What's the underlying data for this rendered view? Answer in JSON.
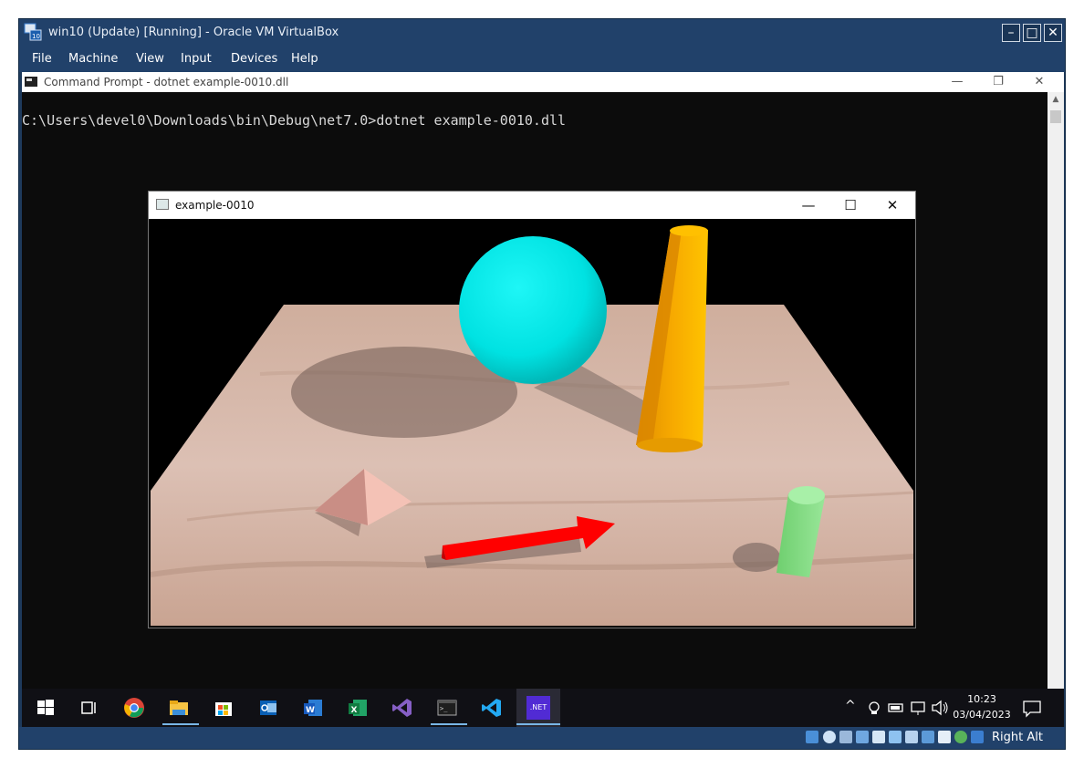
{
  "vbox": {
    "title": "win10 (Update) [Running] - Oracle VM VirtualBox",
    "controls": {
      "minimize": "–",
      "maximize": "□",
      "close": "✕"
    },
    "menu": [
      "File",
      "Machine",
      "View",
      "Input",
      "Devices",
      "Help"
    ],
    "status": {
      "host_key": "Right Alt"
    }
  },
  "cmd": {
    "title": "Command Prompt - dotnet  example-0010.dll",
    "prompt_line": "C:\\Users\\devel0\\Downloads\\bin\\Debug\\net7.0>dotnet example-0010.dll",
    "controls": {
      "minimize": "—",
      "restore": "❐",
      "close": "✕"
    }
  },
  "app_window": {
    "title": "example-0010",
    "controls": {
      "minimize": "—",
      "maximize": "☐",
      "close": "✕"
    }
  },
  "taskbar": {
    "pinned": [
      "start",
      "task-view",
      "chrome",
      "file-explorer",
      "microsoft-store",
      "outlook",
      "word",
      "excel",
      "visual-studio",
      "terminal",
      "vscode",
      "dotnet"
    ],
    "dotnet_label": ".NET",
    "clock": {
      "time": "10:23",
      "date": "03/04/2023"
    }
  },
  "colors": {
    "vbox_frame": "#21416a",
    "sphere": "#00e5e5",
    "cone": "#f5a800",
    "arrow": "#ff0000",
    "cylinder": "#7fd87f",
    "pyramid": "#f2b8ac",
    "floor": "#d9b3a5"
  }
}
